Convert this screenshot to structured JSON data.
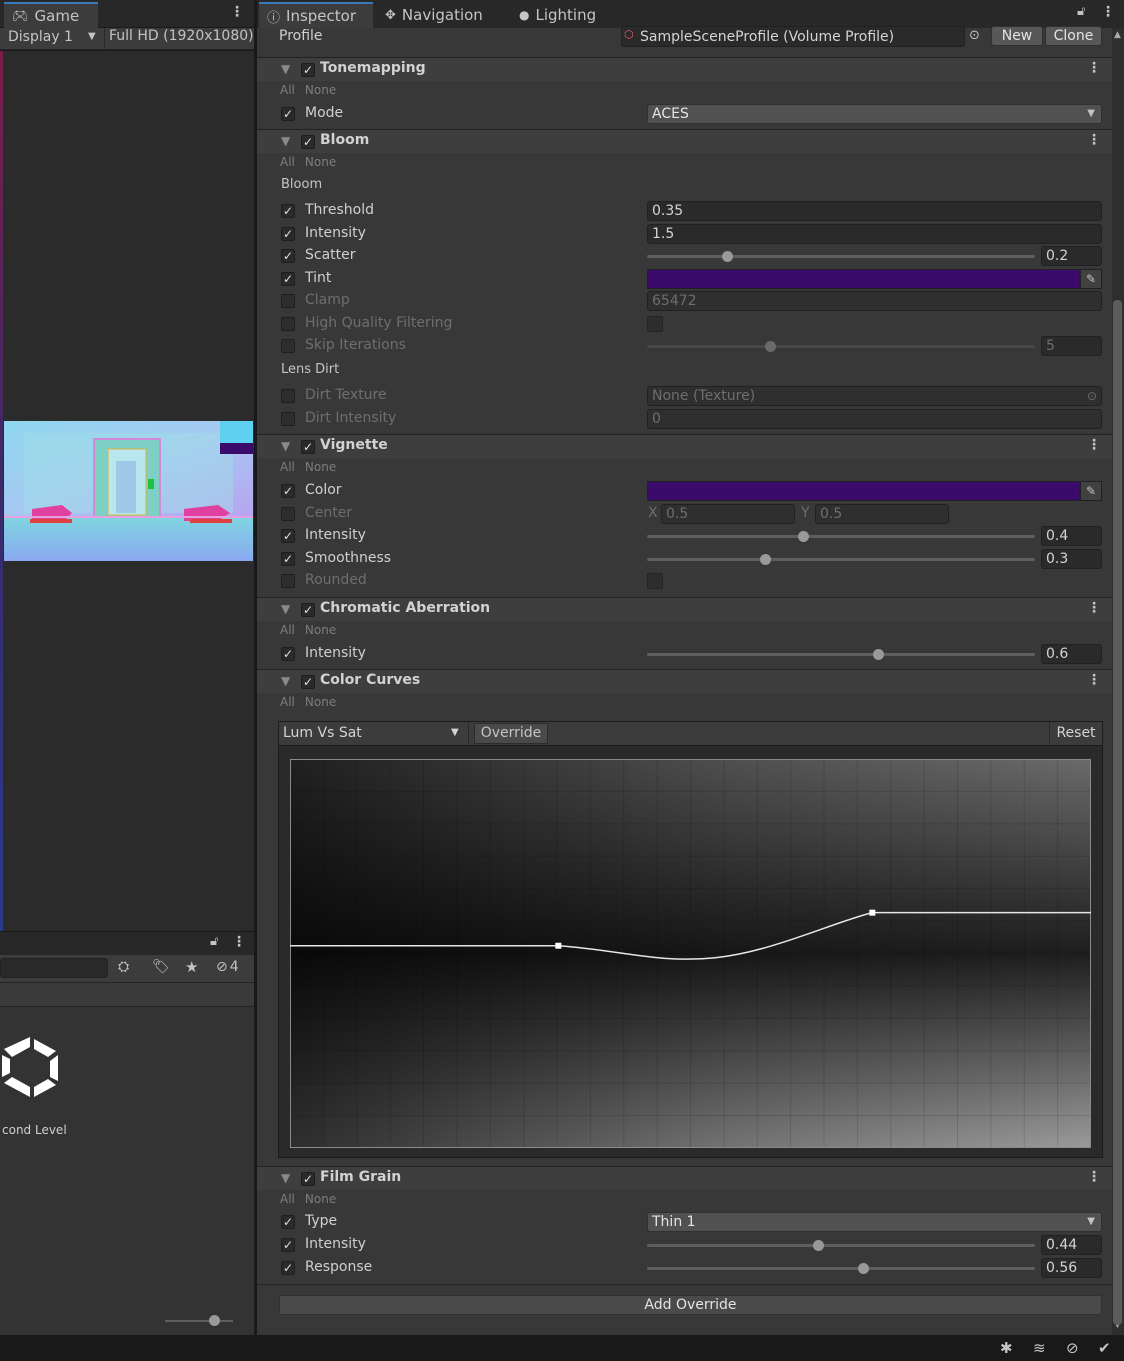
{
  "game": {
    "tab_label": "Game",
    "display": "Display 1",
    "resolution": "Full HD (1920x1080)"
  },
  "project": {
    "hidden_count": "4",
    "asset_label": "cond Level"
  },
  "inspector": {
    "tabs": [
      "Inspector",
      "Navigation",
      "Lighting"
    ],
    "profile_label": "Profile",
    "profile_value": "SampleSceneProfile (Volume Profile)",
    "new_label": "New",
    "clone_label": "Clone",
    "all_label": "All",
    "none_label": "None",
    "tonemapping": {
      "title": "Tonemapping",
      "mode_label": "Mode",
      "mode_value": "ACES"
    },
    "bloom": {
      "title": "Bloom",
      "section_bloom": "Bloom",
      "threshold_label": "Threshold",
      "threshold_value": "0.35",
      "intensity_label": "Intensity",
      "intensity_value": "1.5",
      "scatter_label": "Scatter",
      "scatter_value": "0.2",
      "scatter_fraction": 0.2,
      "tint_label": "Tint",
      "tint_color": "#3a0b6a",
      "clamp_label": "Clamp",
      "clamp_value": "65472",
      "hq_label": "High Quality Filtering",
      "skip_label": "Skip Iterations",
      "skip_value": "5",
      "skip_fraction": 0.3125,
      "section_lens": "Lens Dirt",
      "dirt_texture_label": "Dirt Texture",
      "dirt_texture_value": "None (Texture)",
      "dirt_intensity_label": "Dirt Intensity",
      "dirt_intensity_value": "0"
    },
    "vignette": {
      "title": "Vignette",
      "color_label": "Color",
      "color_value": "#3a0b6a",
      "center_label": "Center",
      "center_x_label": "X",
      "center_x": "0.5",
      "center_y_label": "Y",
      "center_y": "0.5",
      "intensity_label": "Intensity",
      "intensity_value": "0.4",
      "intensity_fraction": 0.4,
      "smoothness_label": "Smoothness",
      "smoothness_value": "0.3",
      "smoothness_fraction": 0.3,
      "rounded_label": "Rounded"
    },
    "chromatic": {
      "title": "Chromatic Aberration",
      "intensity_label": "Intensity",
      "intensity_value": "0.6",
      "intensity_fraction": 0.6
    },
    "curves": {
      "title": "Color Curves",
      "curve_select": "Lum Vs Sat",
      "override_label": "Override",
      "reset_label": "Reset",
      "keys": [
        {
          "x": 0.0,
          "y": 0.52
        },
        {
          "x": 0.335,
          "y": 0.52
        },
        {
          "x": 0.727,
          "y": 0.605
        },
        {
          "x": 1.0,
          "y": 0.605
        }
      ]
    },
    "film_grain": {
      "title": "Film Grain",
      "type_label": "Type",
      "type_value": "Thin 1",
      "intensity_label": "Intensity",
      "intensity_value": "0.44",
      "intensity_fraction": 0.44,
      "response_label": "Response",
      "response_value": "0.56",
      "response_fraction": 0.56
    },
    "add_override_label": "Add Override"
  }
}
